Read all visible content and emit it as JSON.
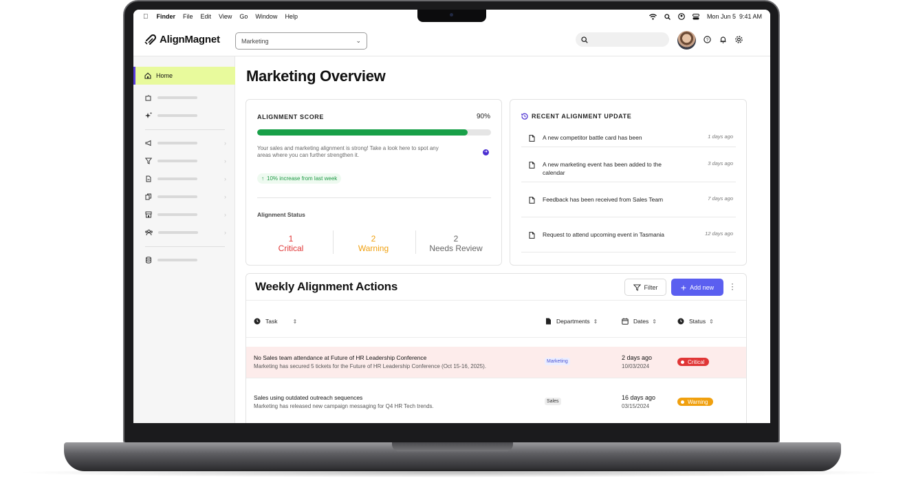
{
  "menubar": {
    "items": [
      "Finder",
      "File",
      "Edit",
      "View",
      "Go",
      "Window",
      "Help"
    ],
    "date": "Mon Jun 5",
    "time": "9:41 AM"
  },
  "header": {
    "logo": "AlignMagnet",
    "department_select": "Marketing",
    "search_placeholder": ""
  },
  "sidebar": {
    "home_label": "Home"
  },
  "page": {
    "title": "Marketing Overview"
  },
  "score": {
    "label": "ALIGNMENT SCORE",
    "value": "90%",
    "progress_fraction": 0.9,
    "description": "Your sales and marketing alignment is strong! Take a look here to spot any areas where you can further strengthen it.",
    "increase": "10% increase from last week",
    "status_title": "Alignment Status",
    "stats": [
      {
        "count": "1",
        "label": "Critical",
        "color": "#e03636"
      },
      {
        "count": "2",
        "label": "Warning",
        "color": "#f0a00f"
      },
      {
        "count": "2",
        "label": "Needs Review",
        "color": "#666666"
      }
    ]
  },
  "updates": {
    "title": "RECENT ALIGNMENT UPDATE",
    "items": [
      {
        "text": "A new competitor battle card has been",
        "ago": "1 days ago"
      },
      {
        "text": "A new marketing event has been added to the calendar",
        "ago": "3 days ago"
      },
      {
        "text": "Feedback has been received from Sales Team",
        "ago": "7 days ago"
      },
      {
        "text": "Request to attend upcoming event in Tasmania",
        "ago": "12 days ago"
      }
    ]
  },
  "actions": {
    "title": "Weekly Alignment Actions",
    "filter_label": "Filter",
    "add_label": "Add new",
    "columns": {
      "task": "Task",
      "departments": "Departments",
      "dates": "Dates",
      "status": "Status"
    },
    "rows": [
      {
        "task": "No Sales team attendance at Future of HR Leadership Conference",
        "detail": "Marketing has secured 5 tickets for the Future of HR Leadership Conference (Oct 15-16, 2025).",
        "department": "Marketing",
        "relative_date": "2 days ago",
        "date": "10/03/2024",
        "status": "Critical"
      },
      {
        "task": "Sales using outdated outreach sequences",
        "detail": "Marketing has released new campaign messaging for Q4 HR Tech trends.",
        "department": "Sales",
        "relative_date": "16 days ago",
        "date": "03/15/2024",
        "status": "Warning"
      }
    ]
  },
  "colors": {
    "accent": "#5b5ff0",
    "home_highlight": "#e8fa9c",
    "progress": "#18a048",
    "critical": "#e03636",
    "warning": "#f0a00f"
  }
}
